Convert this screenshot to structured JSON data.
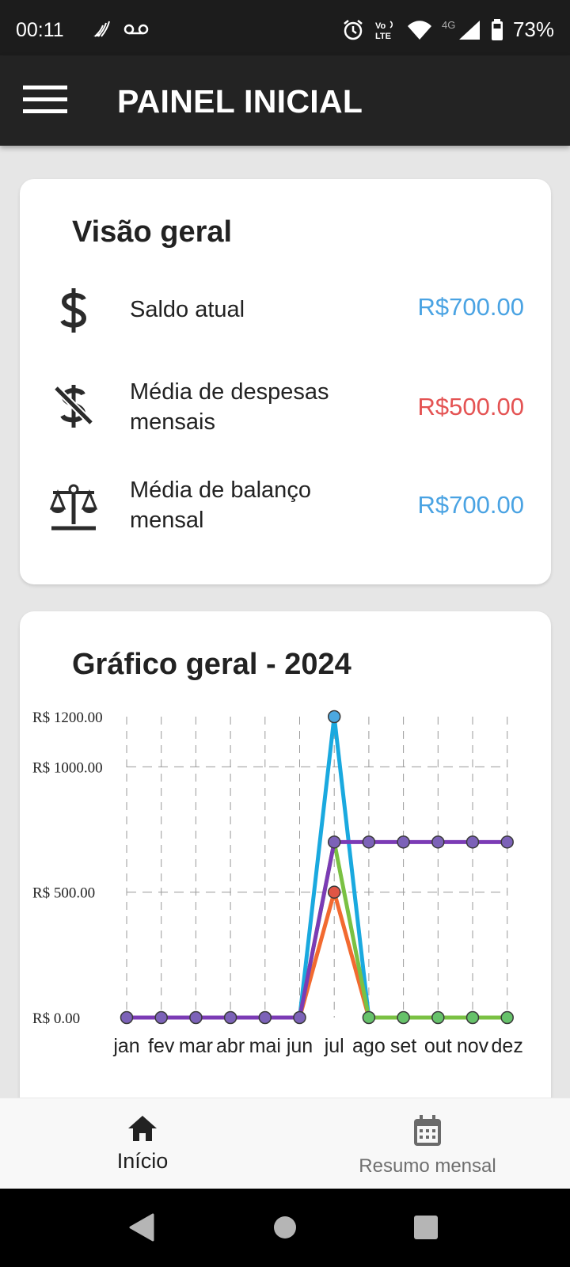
{
  "status_bar": {
    "time": "00:11",
    "battery": "73%",
    "network": "4G",
    "volte": "Vo LTE",
    "icons": [
      "signal-wave-icon",
      "voicemail-icon",
      "alarm-icon",
      "volte-icon",
      "wifi-icon",
      "cell-signal-icon",
      "battery-icon"
    ]
  },
  "app_bar": {
    "title": "PAINEL INICIAL",
    "menu_icon": "hamburger-menu-icon"
  },
  "overview": {
    "title": "Visão geral",
    "rows": [
      {
        "icon": "dollar-icon",
        "label": "Saldo atual",
        "value": "R$700.00",
        "color": "#4aa3e3"
      },
      {
        "icon": "dollar-off-icon",
        "label": "Média de despesas mensais",
        "value": "R$500.00",
        "color": "#e45353"
      },
      {
        "icon": "balance-scale-icon",
        "label": "Média de balanço mensal",
        "value": "R$700.00",
        "color": "#4aa3e3"
      }
    ]
  },
  "chart_card": {
    "title": "Gráfico geral - 2024"
  },
  "chart_data": {
    "type": "line",
    "categories": [
      "jan",
      "fev",
      "mar",
      "abr",
      "mai",
      "jun",
      "jul",
      "ago",
      "set",
      "out",
      "nov",
      "dez"
    ],
    "y_ticks": [
      {
        "value": 0,
        "label": "R$ 0.00"
      },
      {
        "value": 500,
        "label": "R$ 500.00"
      },
      {
        "value": 1000,
        "label": "R$ 1000.00"
      },
      {
        "value": 1200,
        "label": "R$ 1200.00"
      }
    ],
    "ylim": [
      0,
      1200
    ],
    "grid": true,
    "series": [
      {
        "color": "#1aa9df",
        "values": [
          0,
          0,
          0,
          0,
          0,
          0,
          1200,
          0,
          0,
          0,
          0,
          0
        ]
      },
      {
        "color": "#f26a30",
        "values": [
          0,
          0,
          0,
          0,
          0,
          0,
          500,
          0,
          0,
          0,
          0,
          0
        ]
      },
      {
        "color": "#7ac143",
        "values": [
          0,
          0,
          0,
          0,
          0,
          0,
          700,
          0,
          0,
          0,
          0,
          0
        ]
      },
      {
        "color": "#7b3bb5",
        "values": [
          0,
          0,
          0,
          0,
          0,
          0,
          700,
          700,
          700,
          700,
          700,
          700
        ]
      }
    ],
    "markers": [
      {
        "color": "#7c62b8",
        "points": [
          [
            0,
            0
          ],
          [
            1,
            0
          ],
          [
            2,
            0
          ],
          [
            3,
            0
          ],
          [
            4,
            0
          ],
          [
            5,
            0
          ],
          [
            6,
            700
          ],
          [
            7,
            700
          ],
          [
            8,
            700
          ],
          [
            9,
            700
          ],
          [
            10,
            700
          ],
          [
            11,
            700
          ]
        ]
      },
      {
        "color": "#66c26a",
        "points": [
          [
            7,
            0
          ],
          [
            8,
            0
          ],
          [
            9,
            0
          ],
          [
            10,
            0
          ],
          [
            11,
            0
          ]
        ]
      },
      {
        "color": "#e05545",
        "points": [
          [
            6,
            500
          ]
        ]
      },
      {
        "color": "#4ca8e0",
        "points": [
          [
            6,
            1200
          ]
        ]
      }
    ]
  },
  "bottom_nav": {
    "items": [
      {
        "icon": "home-icon",
        "label": "Início",
        "active": true
      },
      {
        "icon": "calendar-icon",
        "label": "Resumo mensal",
        "active": false
      }
    ]
  },
  "system_nav": {
    "icons": [
      "back-triangle-icon",
      "home-circle-icon",
      "recents-square-icon"
    ]
  }
}
